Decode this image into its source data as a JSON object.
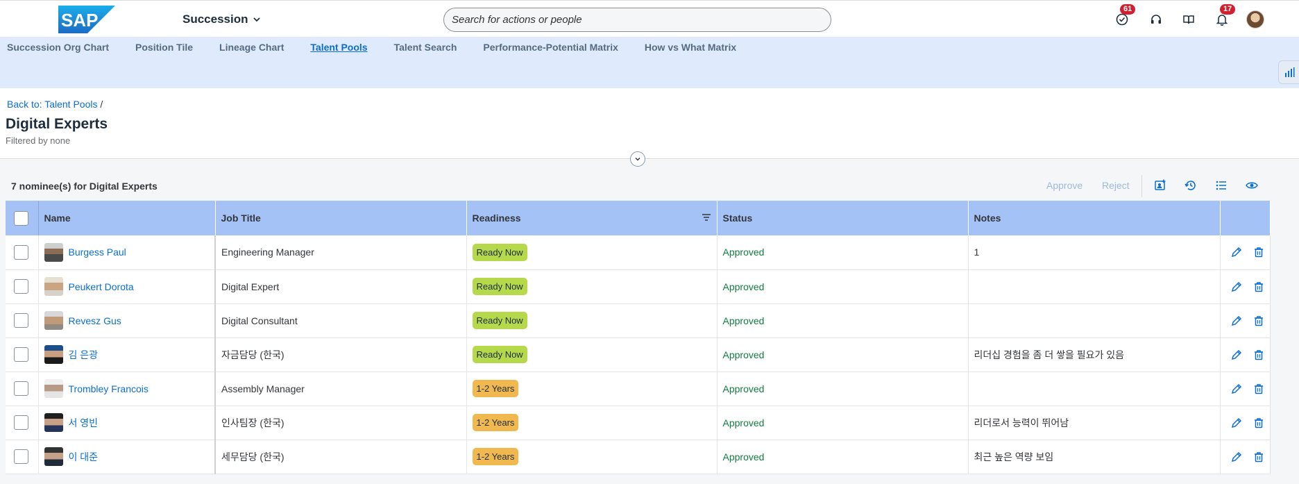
{
  "shell": {
    "logo": "SAP",
    "app_title": "Succession",
    "search_placeholder": "Search for actions or people",
    "todo_count": "61",
    "notif_count": "17"
  },
  "nav": {
    "tabs": [
      {
        "label": "Succession Org Chart"
      },
      {
        "label": "Position Tile"
      },
      {
        "label": "Lineage Chart"
      },
      {
        "label": "Talent Pools",
        "active": true
      },
      {
        "label": "Talent Search"
      },
      {
        "label": "Performance-Potential Matrix"
      },
      {
        "label": "How vs What Matrix"
      }
    ]
  },
  "header": {
    "breadcrumb_link": "Back to: Talent Pools",
    "breadcrumb_sep": "/",
    "title": "Digital Experts",
    "subtitle": "Filtered by none"
  },
  "toolbar": {
    "title": "7 nominee(s) for Digital Experts",
    "approve_label": "Approve",
    "reject_label": "Reject"
  },
  "table": {
    "columns": [
      "Name",
      "Job Title",
      "Readiness",
      "Status",
      "Notes"
    ],
    "rows": [
      {
        "name": "Burgess Paul",
        "job": "Engineering Manager",
        "readiness": "Ready Now",
        "status": "Approved",
        "notes": "1"
      },
      {
        "name": "Peukert Dorota",
        "job": "Digital Expert",
        "readiness": "Ready Now",
        "status": "Approved",
        "notes": ""
      },
      {
        "name": "Revesz Gus",
        "job": "Digital Consultant",
        "readiness": "Ready Now",
        "status": "Approved",
        "notes": ""
      },
      {
        "name": "김 은광",
        "job": "자금담당 (한국)",
        "readiness": "Ready Now",
        "status": "Approved",
        "notes": "리더십 경험을 좀 더 쌓을 필요가 있음"
      },
      {
        "name": "Trombley Francois",
        "job": "Assembly Manager",
        "readiness": "1-2 Years",
        "status": "Approved",
        "notes": ""
      },
      {
        "name": "서 영빈",
        "job": "인사팀장 (한국)",
        "readiness": "1-2 Years",
        "status": "Approved",
        "notes": "리더로서 능력이 뛰어남"
      },
      {
        "name": "이 대준",
        "job": "세무담당 (한국)",
        "readiness": "1-2 Years",
        "status": "Approved",
        "notes": "최근 높은 역량 보임"
      }
    ]
  },
  "colors": {
    "ready_now": "#b5d94a",
    "one_two_years": "#f0b84e",
    "header_row": "#a5c2f7",
    "nav_band": "#dfeafd",
    "link": "#0a6ed1",
    "approved": "#107e3e"
  }
}
